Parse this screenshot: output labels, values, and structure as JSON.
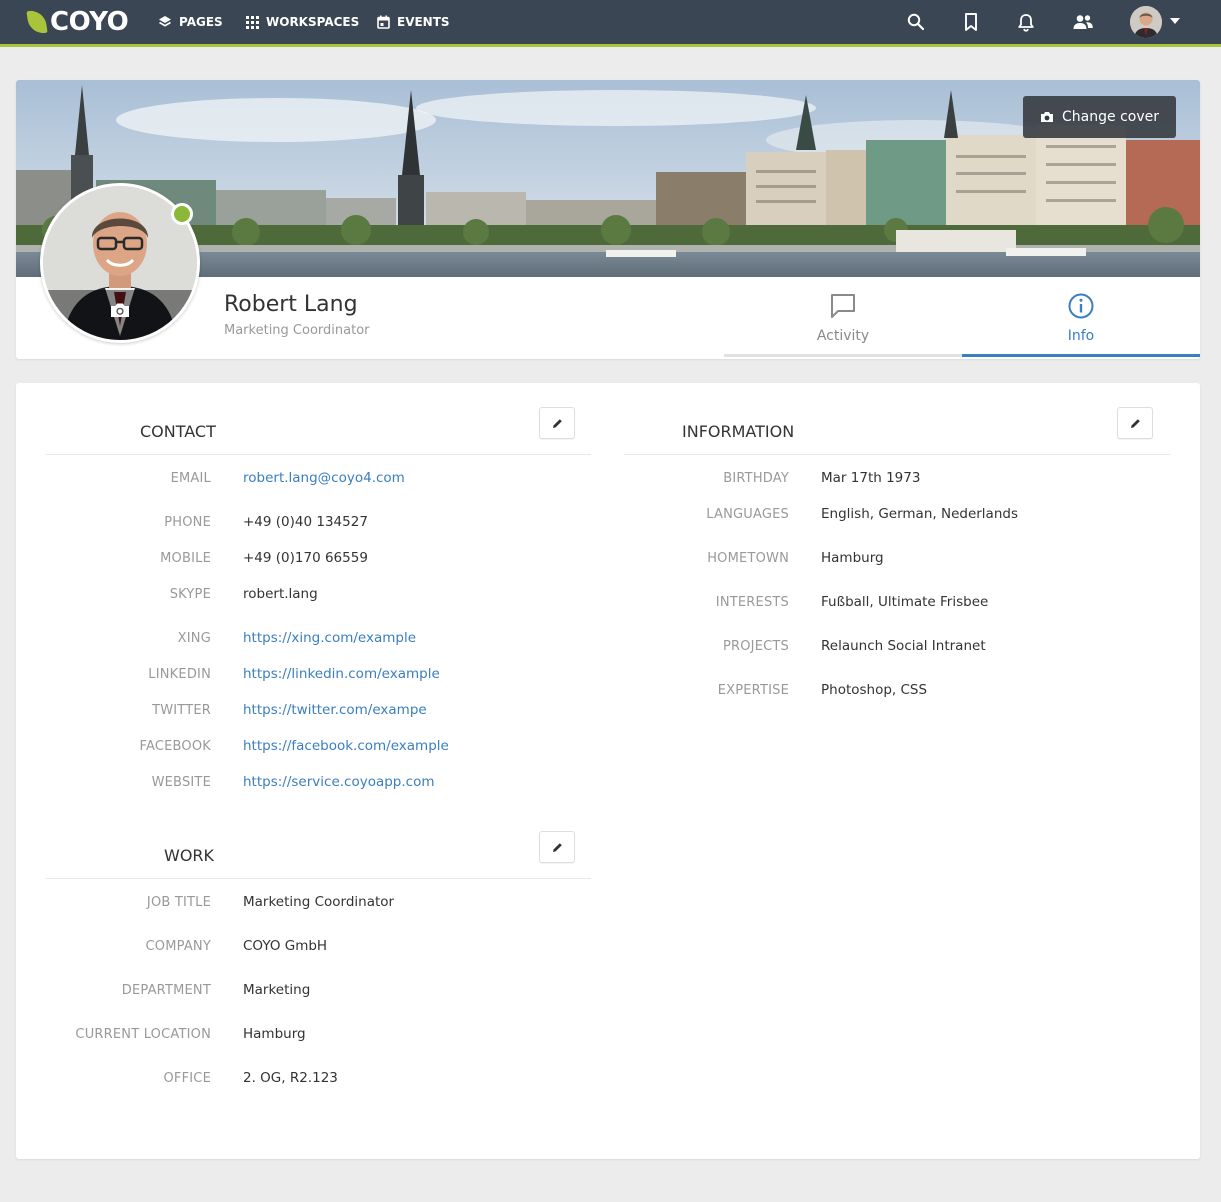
{
  "navbar": {
    "logo_text": "COYO",
    "items": [
      {
        "label": "PAGES"
      },
      {
        "label": "WORKSPACES"
      },
      {
        "label": "EVENTS"
      }
    ],
    "colors": {
      "bar": "#3a4654",
      "accent": "#a7c43a"
    }
  },
  "profile": {
    "name": "Robert Lang",
    "role": "Marketing Coordinator",
    "change_cover_label": "Change cover",
    "status": "online",
    "tabs": [
      {
        "label": "Activity",
        "active": false
      },
      {
        "label": "Info",
        "active": true
      }
    ]
  },
  "contact": {
    "title": "CONTACT",
    "rows": [
      {
        "label": "EMAIL",
        "value": "robert.lang@coyo4.com",
        "link": true
      },
      {
        "label": "PHONE",
        "value": "+49 (0)40 134527",
        "link": false
      },
      {
        "label": "MOBILE",
        "value": "+49 (0)170 66559",
        "link": false
      },
      {
        "label": "SKYPE",
        "value": "robert.lang",
        "link": false
      },
      {
        "label": "XING",
        "value": "https://xing.com/example",
        "link": true
      },
      {
        "label": "LINKEDIN",
        "value": "https://linkedin.com/example",
        "link": true
      },
      {
        "label": "TWITTER",
        "value": "https://twitter.com/exampe",
        "link": true
      },
      {
        "label": "FACEBOOK",
        "value": "https://facebook.com/example",
        "link": true
      },
      {
        "label": "WEBSITE",
        "value": "https://service.coyoapp.com",
        "link": true
      }
    ]
  },
  "work": {
    "title": "WORK",
    "rows": [
      {
        "label": "JOB TITLE",
        "value": "Marketing Coordinator"
      },
      {
        "label": "COMPANY",
        "value": "COYO GmbH"
      },
      {
        "label": "DEPARTMENT",
        "value": "Marketing"
      },
      {
        "label": "CURRENT LOCATION",
        "value": "Hamburg"
      },
      {
        "label": "OFFICE",
        "value": "2. OG, R2.123"
      }
    ]
  },
  "information": {
    "title": "INFORMATION",
    "rows": [
      {
        "label": "BIRTHDAY",
        "value": "Mar 17th 1973"
      },
      {
        "label": "LANGUAGES",
        "value": "English, German, Nederlands"
      },
      {
        "label": "HOMETOWN",
        "value": "Hamburg"
      },
      {
        "label": "INTERESTS",
        "value": "Fußball, Ultimate Frisbee"
      },
      {
        "label": "PROJECTS",
        "value": "Relaunch Social Intranet"
      },
      {
        "label": "EXPERTISE",
        "value": "Photoshop, CSS"
      }
    ]
  }
}
